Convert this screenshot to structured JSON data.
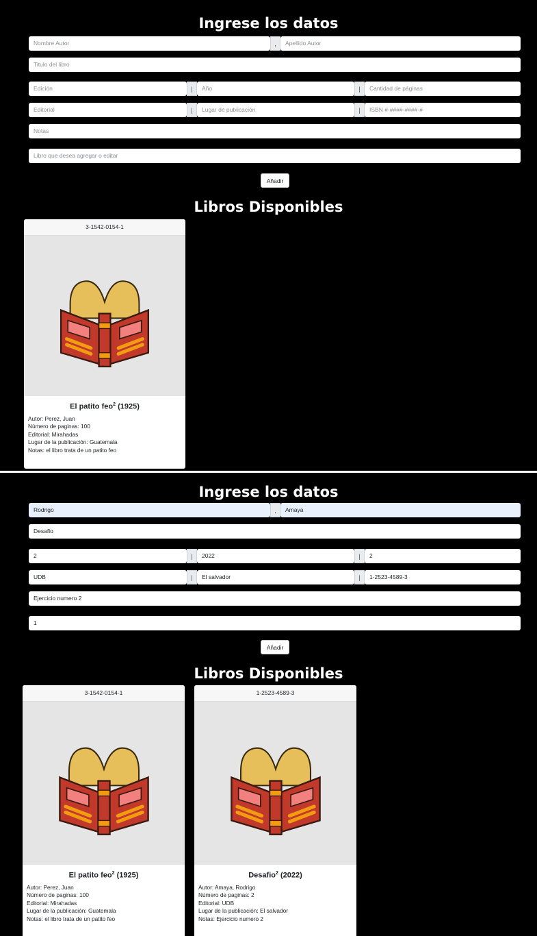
{
  "form_top": {
    "title": "Ingrese los datos",
    "nombre_autor_placeholder": "Nombre Autor",
    "name_sep": ",",
    "apellido_autor_placeholder": "Apellido Autor",
    "titulo_placeholder": "Titulo del libro",
    "edicion_placeholder": "Edición",
    "pipe": "|",
    "anio_placeholder": "Año",
    "paginas_placeholder": "Cantidad de páginas",
    "editorial_placeholder": "Editorial",
    "lugar_placeholder": "Lugar de publicación",
    "isbn_placeholder": "ISBN #-####-####-#",
    "notas_placeholder": "Notas",
    "libro_placeholder": "Libro que desea agregar o editar",
    "add_button": "Añadir",
    "list_title": "Libros Disponibles"
  },
  "form_bottom": {
    "title": "Ingrese los datos",
    "nombre_autor_value": "Rodrigo",
    "name_sep": ",",
    "apellido_autor_value": "Amaya",
    "titulo_value": "Desafio",
    "edicion_value": "2",
    "pipe": "|",
    "anio_value": "2022",
    "paginas_value": "2",
    "editorial_value": "UDB",
    "lugar_value": "El salvador",
    "isbn_value": "1-2523-4589-3",
    "notas_value": "Ejercicio numero 2",
    "libro_value": "1",
    "add_button": "Añadir",
    "list_title": "Libros Disponibles"
  },
  "books": [
    {
      "isbn": "3-1542-0154-1",
      "title": "El patito feo",
      "edition": "2",
      "year": "(1925)",
      "author": "Autor: Perez, Juan",
      "pages": "Número de paginas: 100",
      "editorial": "Editorial: Mirahadas",
      "place": "Lugar de la publicación: Guatemala",
      "notes": "Notas: el libro trata de un patito feo"
    },
    {
      "isbn": "1-2523-4589-3",
      "title": "Desafio",
      "edition": "2",
      "year": "(2022)",
      "author": "Autor: Amaya, Rodrigo",
      "pages": "Número de paginas: 2",
      "editorial": "Editorial: UDB",
      "place": "Lugar de la publicación: El salvador",
      "notes": "Notas: Ejercicio numero 2"
    }
  ],
  "colors": {
    "background": "#000000",
    "book_cover": "#c0392b",
    "book_pages": "#e6bf5a",
    "book_accent": "#f39c12",
    "book_window": "#f1807e"
  },
  "icons": {
    "book_image": "open-book-icon"
  }
}
